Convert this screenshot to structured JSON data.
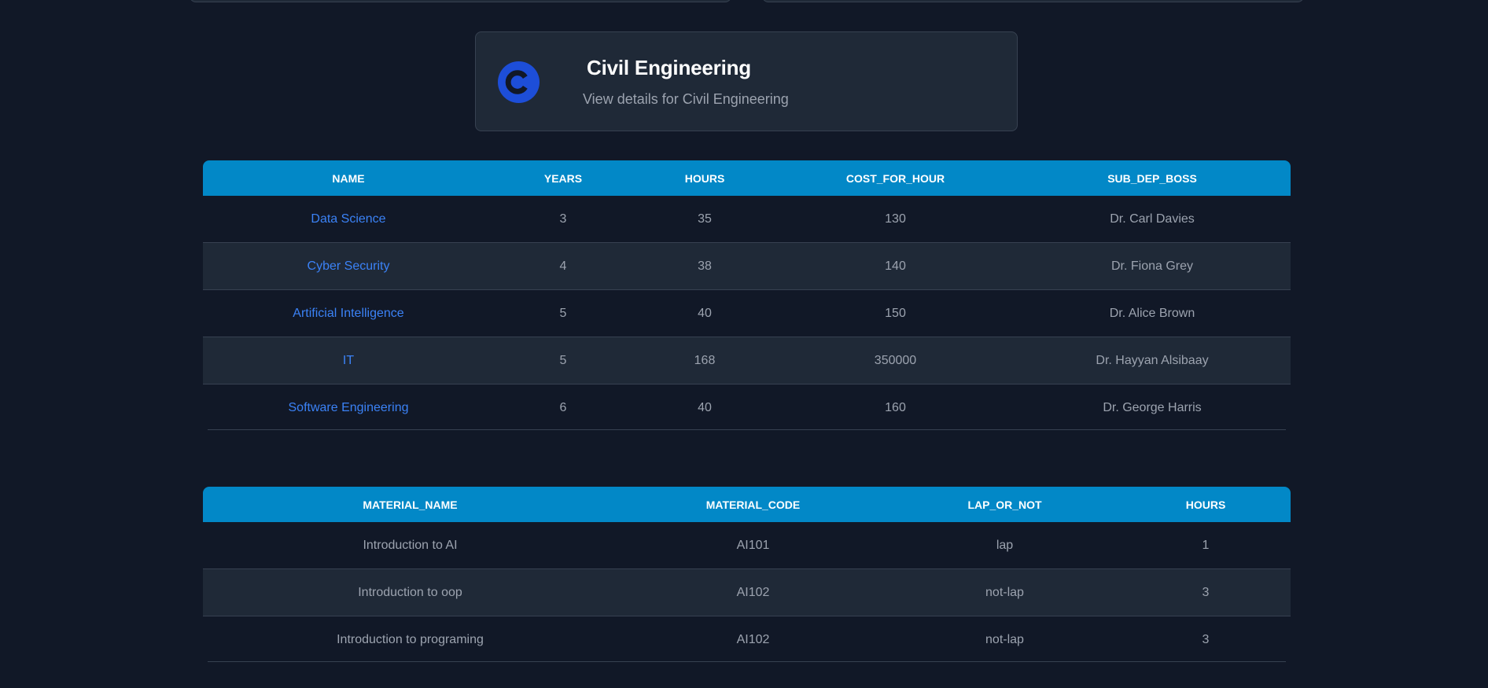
{
  "department": {
    "title": "Civil Engineering",
    "subtitle": "View details for Civil Engineering",
    "icon": "copyright-c-icon",
    "icon_color": "#1d4ed8"
  },
  "colors": {
    "background": "#111827",
    "card": "#1f2937",
    "header": "#0288c7",
    "link": "#3b82f6",
    "text_muted": "#9ca3af"
  },
  "sub_departments": {
    "columns": [
      "NAME",
      "YEARS",
      "HOURS",
      "COST_FOR_HOUR",
      "SUB_DEP_BOSS"
    ],
    "rows": [
      [
        "Data Science",
        "3",
        "35",
        "130",
        "Dr. Carl Davies"
      ],
      [
        "Cyber Security",
        "4",
        "38",
        "140",
        "Dr. Fiona Grey"
      ],
      [
        "Artificial Intelligence",
        "5",
        "40",
        "150",
        "Dr. Alice Brown"
      ],
      [
        "IT",
        "5",
        "168",
        "350000",
        "Dr. Hayyan Alsibaay"
      ],
      [
        "Software Engineering",
        "6",
        "40",
        "160",
        "Dr. George Harris"
      ]
    ]
  },
  "materials": {
    "columns": [
      "MATERIAL_NAME",
      "MATERIAL_CODE",
      "LAP_OR_NOT",
      "HOURS"
    ],
    "rows": [
      [
        "Introduction to AI",
        "AI101",
        "lap",
        "1"
      ],
      [
        "Introduction to oop",
        "AI102",
        "not-lap",
        "3"
      ],
      [
        "Introduction to programing",
        "AI102",
        "not-lap",
        "3"
      ]
    ]
  }
}
